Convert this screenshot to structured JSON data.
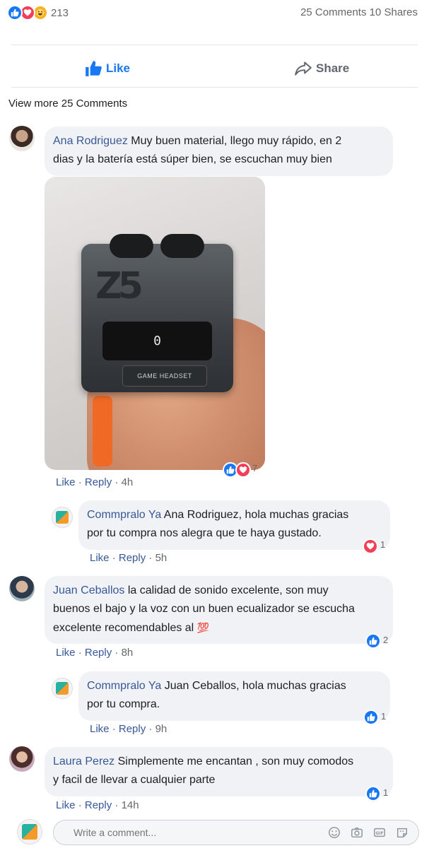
{
  "header": {
    "reaction_count": "213",
    "stats": "25 Comments 10 Shares",
    "like_label": "Like",
    "share_label": "Share",
    "view_more": "View more 25 Comments"
  },
  "comments": [
    {
      "author": "Ana Rodriguez",
      "text_line1": "Muy buen material, llego muy rápido, en 2",
      "text_line2": "dias y la batería está súper bien, se escuchan muy bien",
      "photo": {
        "display": "0",
        "label": "GAME HEADSET"
      },
      "reactions": "7",
      "like": "Like",
      "reply": "Reply",
      "time": "4h"
    },
    {
      "author": "Commpralo Ya",
      "text_line1": "Ana Rodriguez, hola muchas gracias",
      "text_line2": "por tu compra nos alegra que te haya gustado.",
      "reactions": "1",
      "like": "Like",
      "reply": "Reply",
      "time": "5h"
    },
    {
      "author": "Juan Ceballos",
      "text_line1": "la calidad de sonido excelente, son muy",
      "text_line2": "buenos el bajo y la voz con un buen ecualizador se escucha",
      "text_line3": "excelente recomendables al",
      "emoji": "💯",
      "reactions": "2",
      "like": "Like",
      "reply": "Reply",
      "time": "8h"
    },
    {
      "author": "Commpralo Ya",
      "text_line1": "Juan Ceballos, hola muchas gracias",
      "text_line2": "por tu compra.",
      "reactions": "1",
      "like": "Like",
      "reply": "Reply",
      "time": "9h"
    },
    {
      "author": "Laura Perez",
      "text_line1": "Simplemente me encantan , son muy comodos",
      "text_line2": "y facil de llevar a cualquier parte",
      "reactions": "1",
      "like": "Like",
      "reply": "Reply",
      "time": "14h"
    }
  ],
  "composer": {
    "placeholder": "Write a comment...",
    "gif_label": "GIF"
  },
  "colors": {
    "like_blue": "#1877f2",
    "love_red": "#f33e58",
    "author_blue": "#385898",
    "bubble_bg": "#f0f2f5"
  },
  "icons": [
    "like-icon",
    "love-icon",
    "haha-icon",
    "share-icon",
    "emoji-icon",
    "camera-icon",
    "gif-icon",
    "sticker-icon"
  ]
}
